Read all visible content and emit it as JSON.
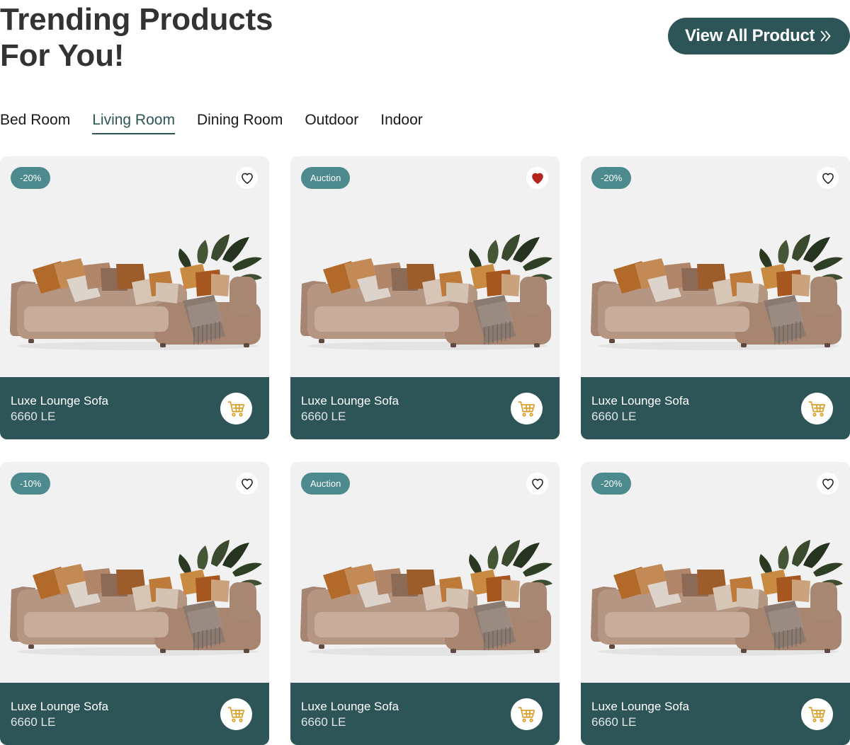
{
  "header": {
    "title_line1": "Trending Products",
    "title_line2": "For You!",
    "view_all_label": "View All Product"
  },
  "tabs": [
    {
      "label": "Bed Room",
      "active": false
    },
    {
      "label": "Living Room",
      "active": true
    },
    {
      "label": "Dining Room",
      "active": false
    },
    {
      "label": "Outdoor",
      "active": false
    },
    {
      "label": "Indoor",
      "active": false
    }
  ],
  "products": [
    {
      "badge": "-20%",
      "name": "Luxe Lounge Sofa",
      "price": "6660 LE",
      "favorited": false
    },
    {
      "badge": "Auction",
      "name": "Luxe Lounge Sofa",
      "price": "6660 LE",
      "favorited": true
    },
    {
      "badge": "-20%",
      "name": "Luxe Lounge Sofa",
      "price": "6660 LE",
      "favorited": false
    },
    {
      "badge": "-10%",
      "name": "Luxe Lounge Sofa",
      "price": "6660 LE",
      "favorited": false
    },
    {
      "badge": "Auction",
      "name": "Luxe Lounge Sofa",
      "price": "6660 LE",
      "favorited": false
    },
    {
      "badge": "-20%",
      "name": "Luxe Lounge Sofa",
      "price": "6660 LE",
      "favorited": false
    }
  ],
  "icons": {
    "view_all": "double-chevron-right-icon",
    "favorite": "heart-icon",
    "cart": "shopping-cart-icon",
    "product_image": "sofa-image"
  },
  "colors": {
    "primary": "#2d5456",
    "badge": "#4d8a8d",
    "card_background": "#f1f1f1",
    "cart_icon": "#d9a12b",
    "favorite_active": "#b3261e"
  }
}
